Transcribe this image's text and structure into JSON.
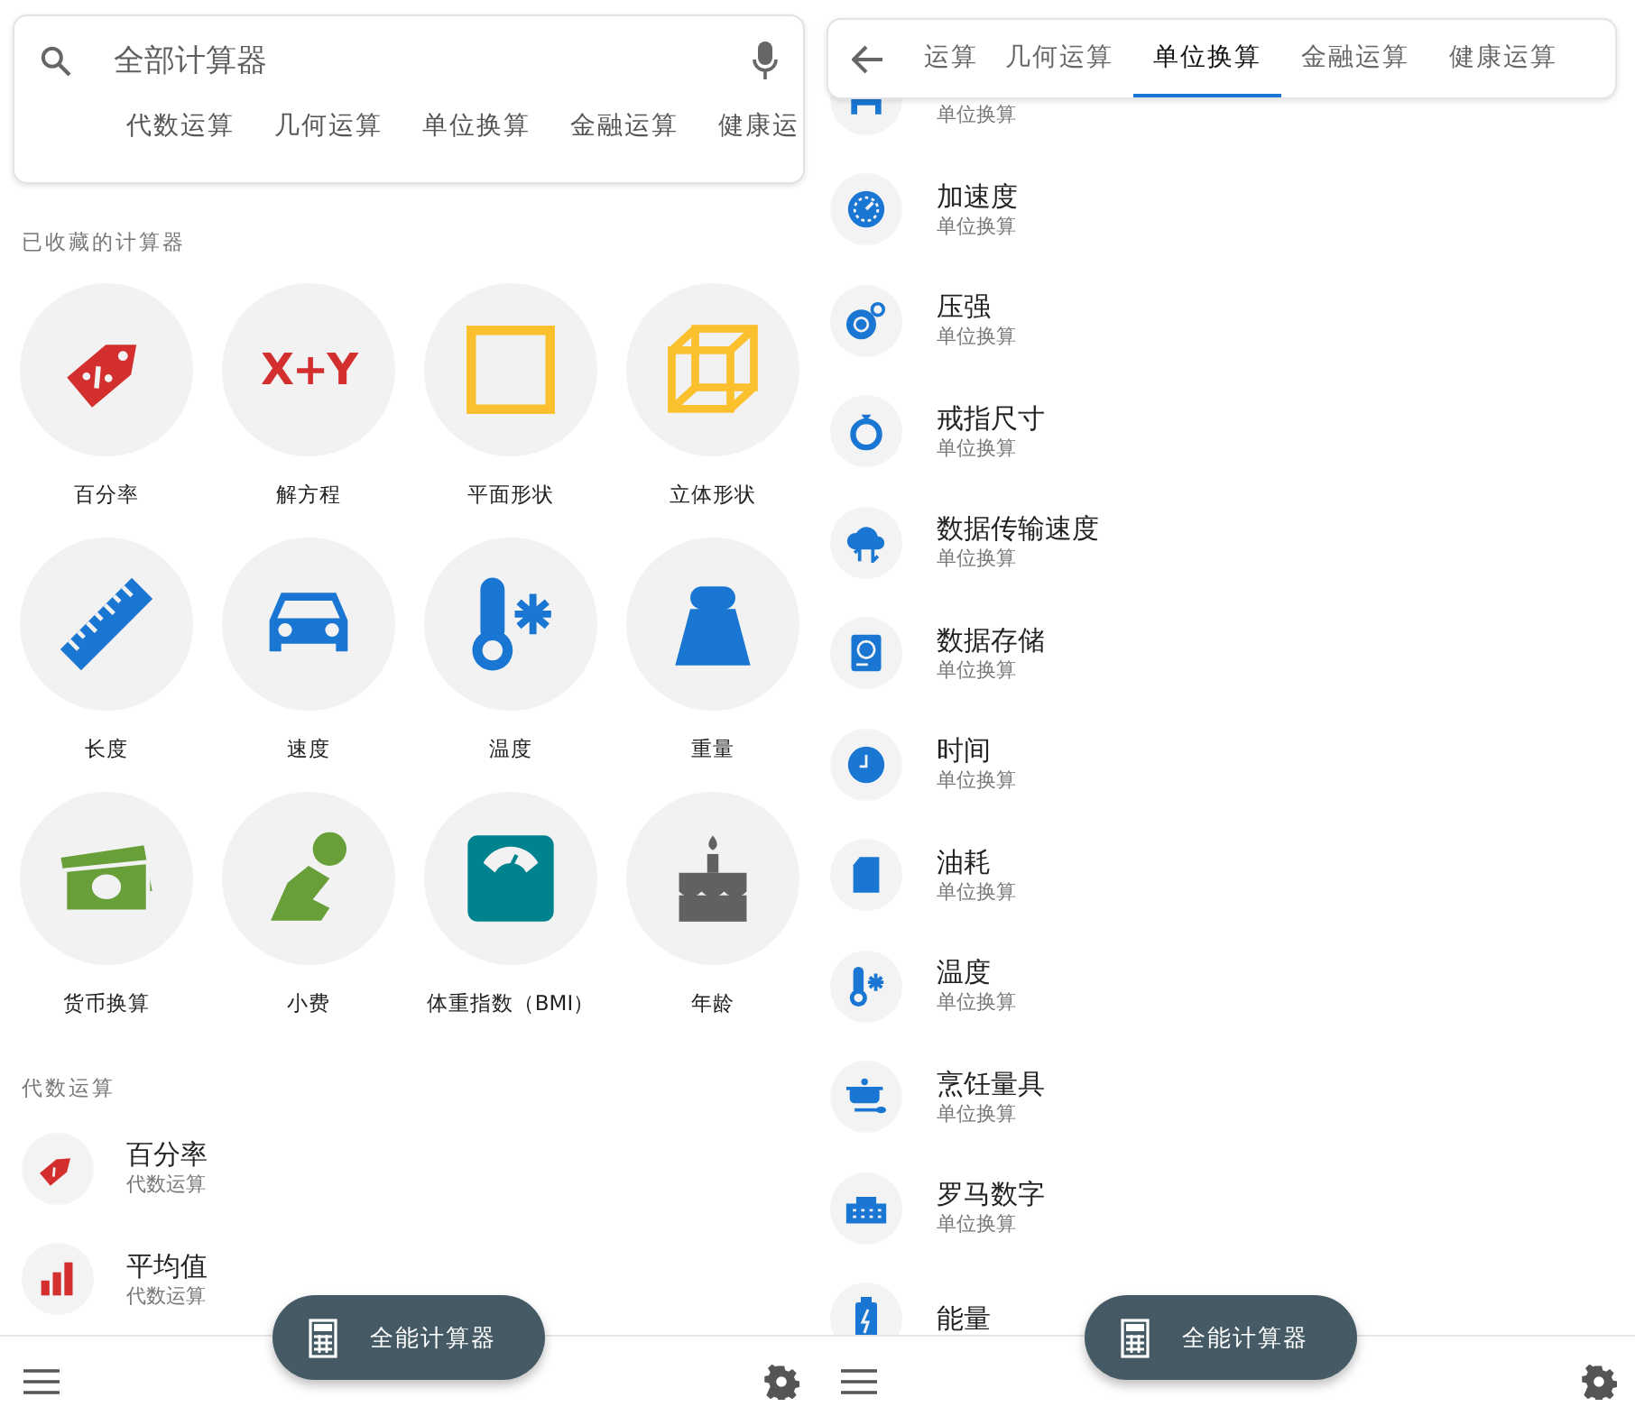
{
  "left_screen": {
    "search": {
      "placeholder": "全部计算器"
    },
    "categories": [
      "代数运算",
      "几何运算",
      "单位换算",
      "金融运算",
      "健康运"
    ],
    "favorites_heading": "已收藏的计算器",
    "favorites": [
      {
        "label": "百分率",
        "color": "#d32f2f"
      },
      {
        "label": "解方程",
        "color": "#d32f2f",
        "glyph": "X+Y"
      },
      {
        "label": "平面形状",
        "color": "#fbc02d"
      },
      {
        "label": "立体形状",
        "color": "#fbc02d"
      },
      {
        "label": "长度",
        "color": "#1976d2"
      },
      {
        "label": "速度",
        "color": "#1976d2"
      },
      {
        "label": "温度",
        "color": "#1976d2"
      },
      {
        "label": "重量",
        "color": "#1976d2"
      },
      {
        "label": "货币换算",
        "color": "#689f38"
      },
      {
        "label": "小费",
        "color": "#689f38"
      },
      {
        "label": "体重指数（BMI）",
        "color": "#00838f"
      },
      {
        "label": "年龄",
        "color": "#616161"
      }
    ],
    "section_heading": "代数运算",
    "list": [
      {
        "title": "百分率",
        "subtitle": "代数运算"
      },
      {
        "title": "平均值",
        "subtitle": "代数运算"
      }
    ],
    "fab": {
      "label": "全能计算器"
    }
  },
  "right_screen": {
    "tabs": [
      {
        "label": "运算",
        "selected": false
      },
      {
        "label": "几何运算",
        "selected": false
      },
      {
        "label": "单位换算",
        "selected": true
      },
      {
        "label": "金融运算",
        "selected": false
      },
      {
        "label": "健康运算",
        "selected": false
      }
    ],
    "list": [
      {
        "subtitle": "单位换算"
      },
      {
        "title": "加速度",
        "subtitle": "单位换算"
      },
      {
        "title": "压强",
        "subtitle": "单位换算"
      },
      {
        "title": "戒指尺寸",
        "subtitle": "单位换算"
      },
      {
        "title": "数据传输速度",
        "subtitle": "单位换算"
      },
      {
        "title": "数据存储",
        "subtitle": "单位换算"
      },
      {
        "title": "时间",
        "subtitle": "单位换算"
      },
      {
        "title": "油耗",
        "subtitle": "单位换算"
      },
      {
        "title": "温度",
        "subtitle": "单位换算"
      },
      {
        "title": "烹饪量具",
        "subtitle": "单位换算"
      },
      {
        "title": "罗马数字",
        "subtitle": "单位换算"
      },
      {
        "title": "能量"
      }
    ],
    "fab": {
      "label": "全能计算器"
    }
  }
}
